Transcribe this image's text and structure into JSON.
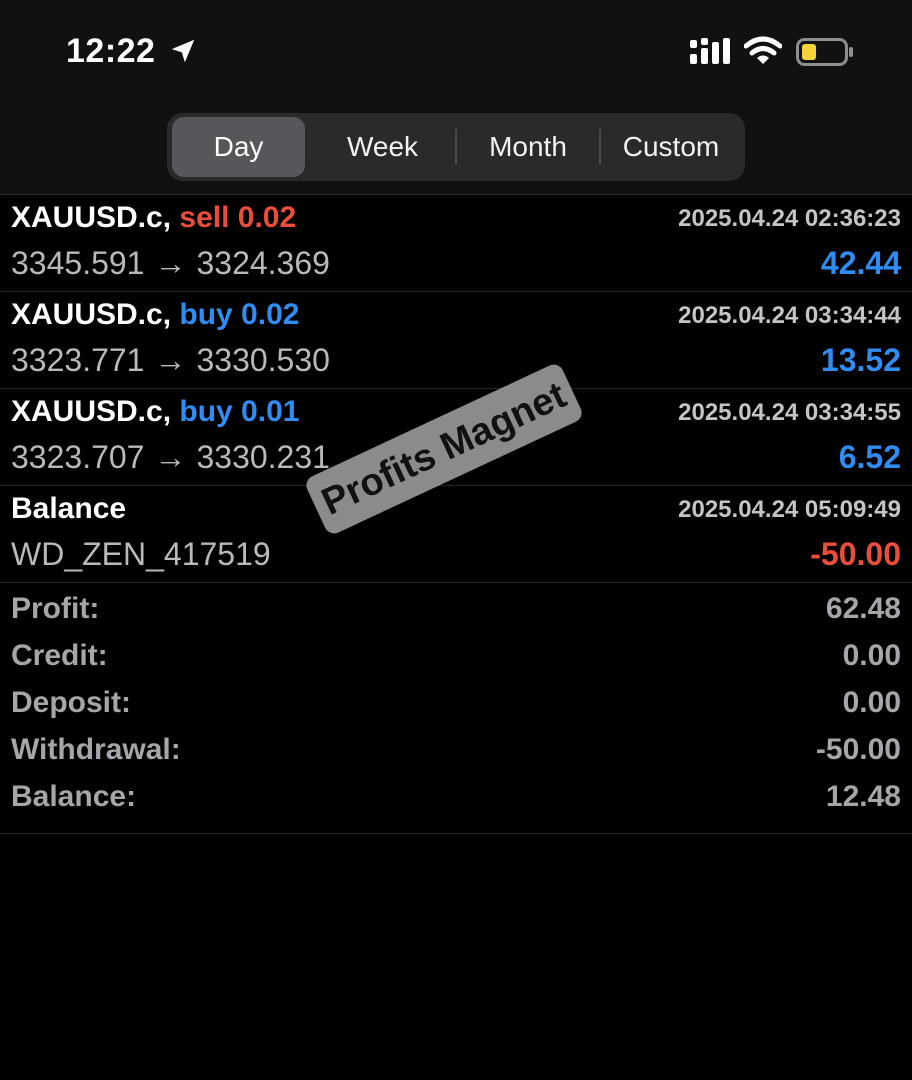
{
  "status_bar": {
    "time": "12:22",
    "icons": [
      "location-arrow-icon",
      "cellular-signal-icon",
      "wifi-icon",
      "battery-low-icon"
    ],
    "battery_color": "#f7d13a"
  },
  "period_tabs": {
    "selected": "Day",
    "items": [
      {
        "label": "Day"
      },
      {
        "label": "Week"
      },
      {
        "label": "Month"
      },
      {
        "label": "Custom"
      }
    ]
  },
  "colors": {
    "sell": "#eb4d3d",
    "buy": "#2f8cf2",
    "negative": "#eb4d3d",
    "positive": "#2f8cf2"
  },
  "deals": [
    {
      "symbol": "XAUUSD.c,",
      "side": "sell 0.02",
      "datetime": "2025.04.24 02:36:23",
      "open_price": "3345.591",
      "arrow": "→",
      "close_price": "3324.369",
      "profit": "42.44"
    },
    {
      "symbol": "XAUUSD.c,",
      "side": "buy 0.02",
      "datetime": "2025.04.24 03:34:44",
      "open_price": "3323.771",
      "arrow": "→",
      "close_price": "3330.530",
      "profit": "13.52"
    },
    {
      "symbol": "XAUUSD.c,",
      "side": "buy 0.01",
      "datetime": "2025.04.24 03:34:55",
      "open_price": "3323.707",
      "arrow": "→",
      "close_price": "3330.231",
      "profit": "6.52"
    }
  ],
  "balance_op": {
    "title": "Balance",
    "datetime": "2025.04.24 05:09:49",
    "comment": "WD_ZEN_417519",
    "amount": "-50.00"
  },
  "summary": [
    {
      "label": "Profit:",
      "value": "62.48"
    },
    {
      "label": "Credit:",
      "value": "0.00"
    },
    {
      "label": "Deposit:",
      "value": "0.00"
    },
    {
      "label": "Withdrawal:",
      "value": "-50.00"
    },
    {
      "label": "Balance:",
      "value": "12.48"
    }
  ],
  "watermark": "Profits Magnet"
}
